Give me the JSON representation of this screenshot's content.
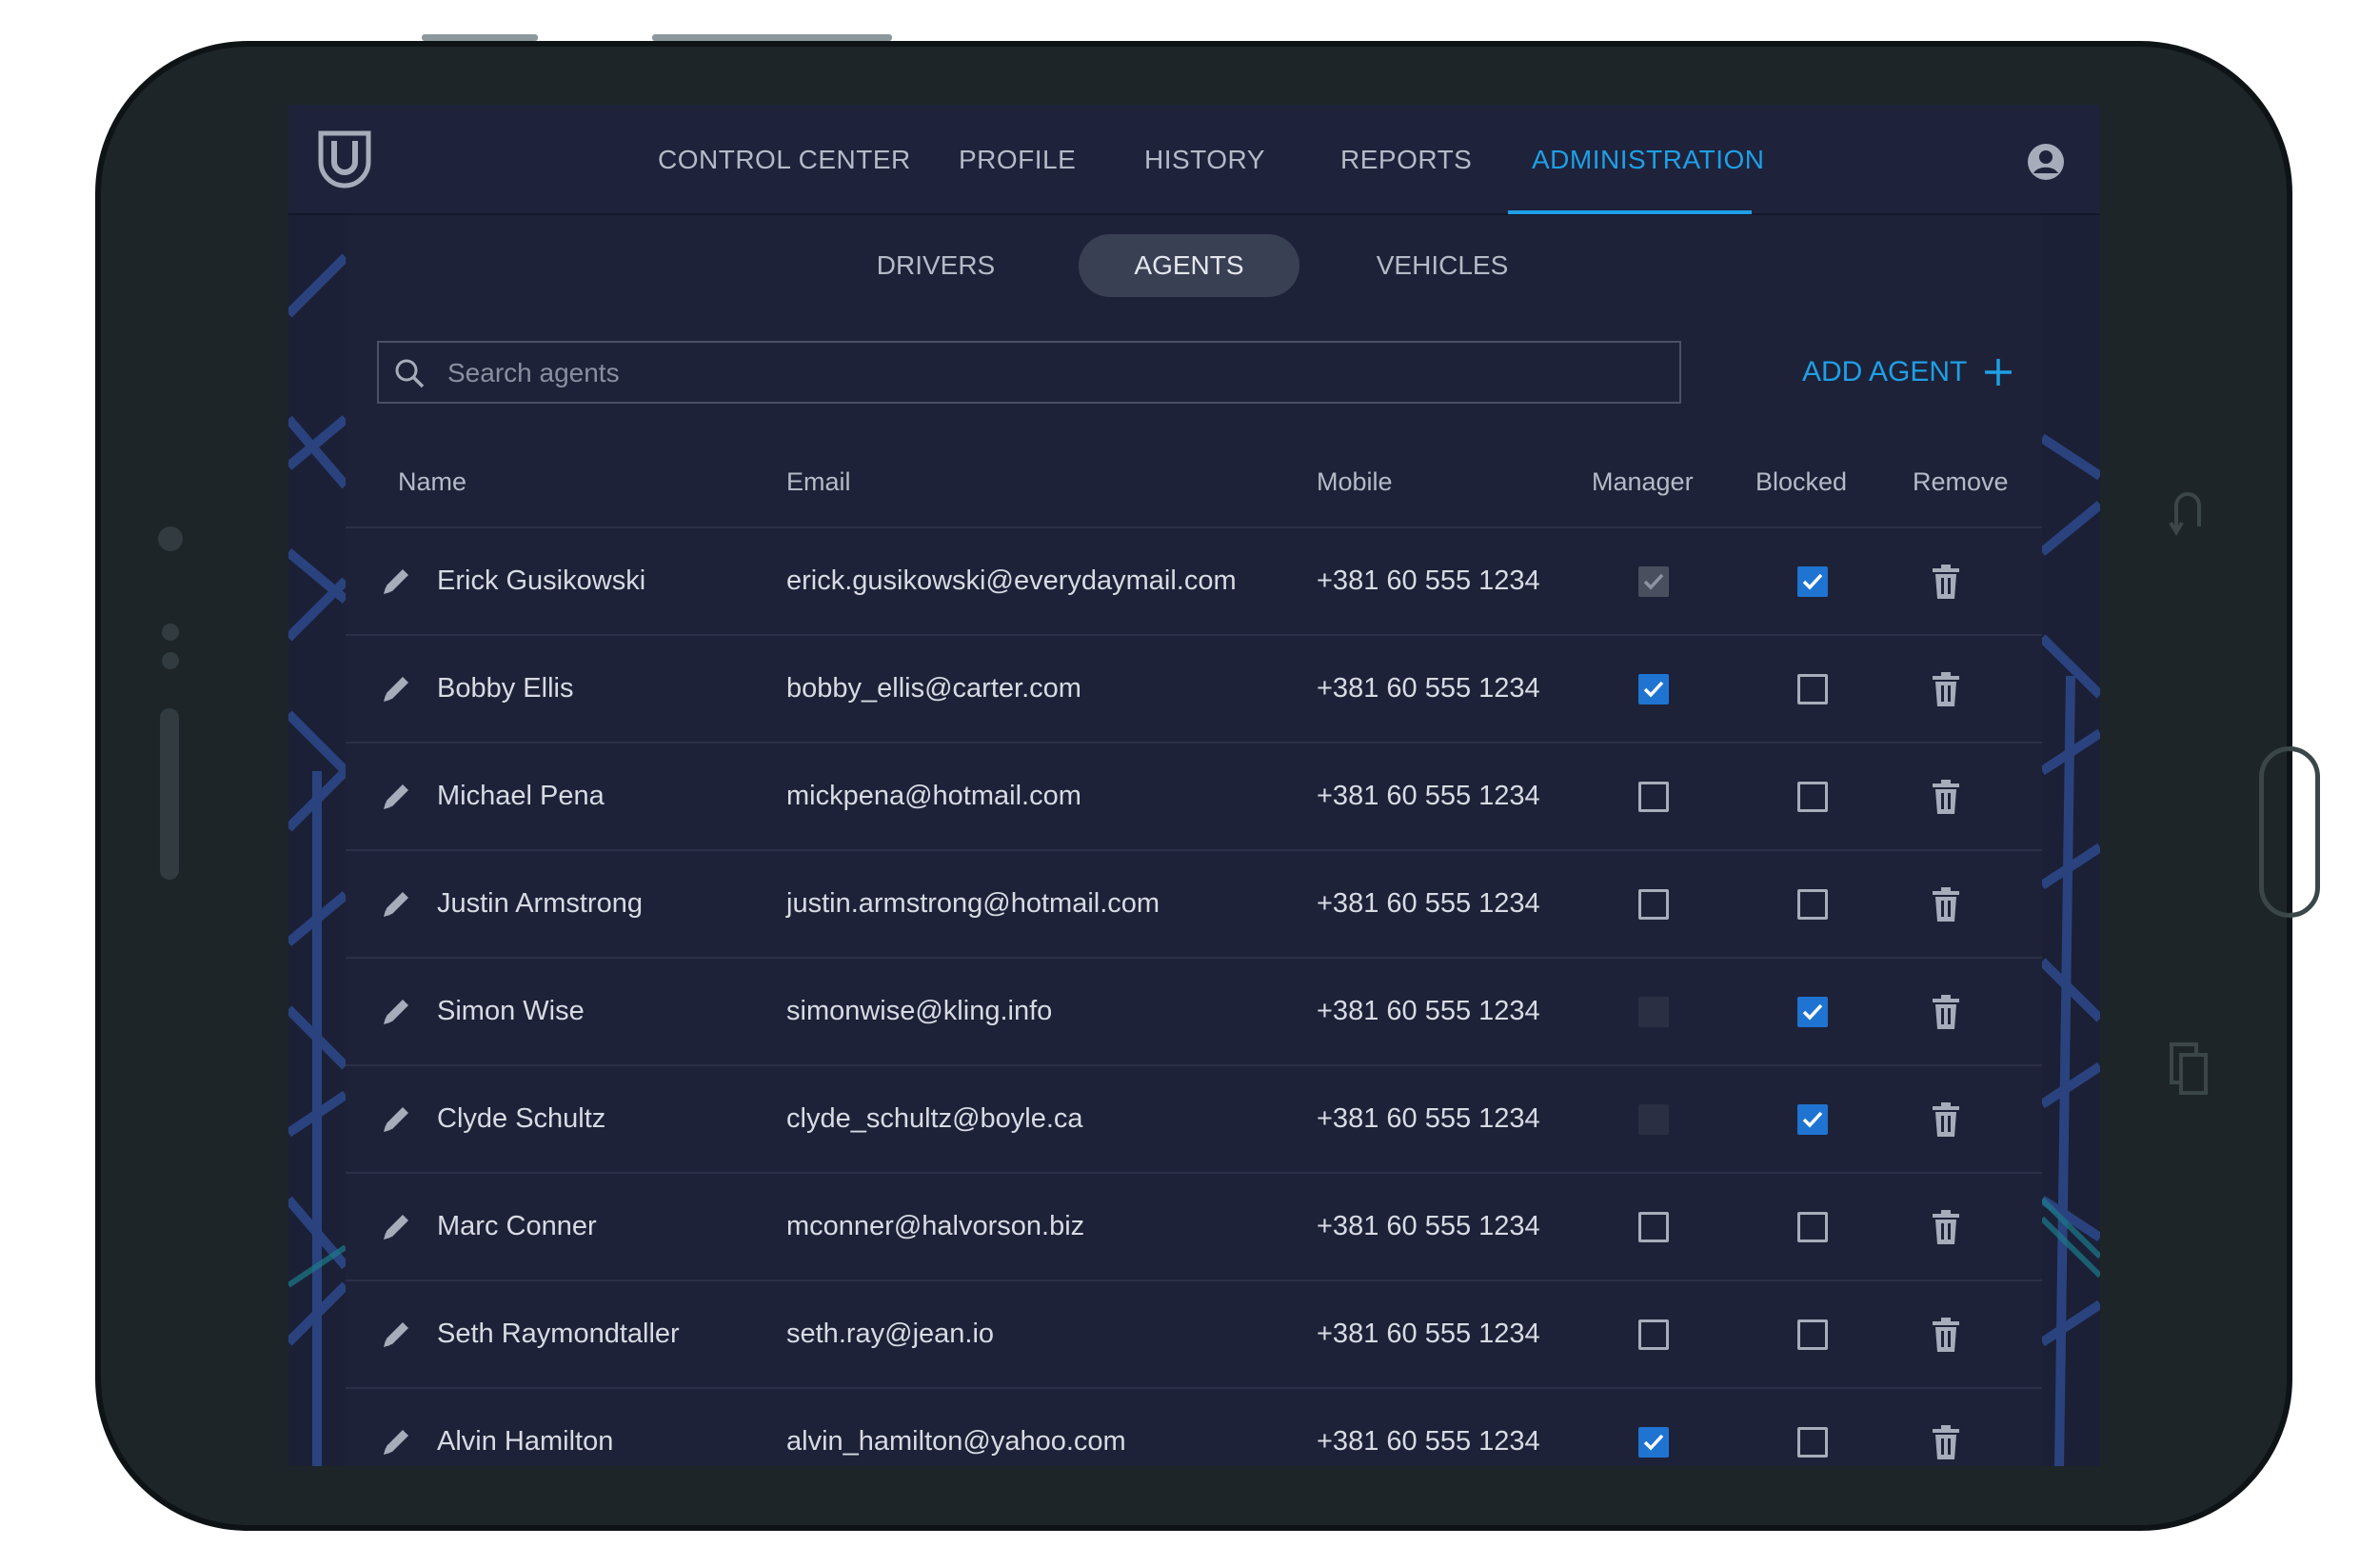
{
  "nav": {
    "tabs": [
      {
        "label": "CONTROL CENTER"
      },
      {
        "label": "PROFILE"
      },
      {
        "label": "HISTORY"
      },
      {
        "label": "REPORTS"
      },
      {
        "label": "ADMINISTRATION",
        "active": true
      }
    ]
  },
  "subtabs": [
    {
      "label": "DRIVERS"
    },
    {
      "label": "AGENTS",
      "active": true
    },
    {
      "label": "VEHICLES"
    }
  ],
  "search": {
    "placeholder": "Search agents",
    "value": ""
  },
  "add_button": {
    "label": "ADD AGENT"
  },
  "table": {
    "headers": {
      "name": "Name",
      "email": "Email",
      "mobile": "Mobile",
      "manager": "Manager",
      "blocked": "Blocked",
      "remove": "Remove"
    },
    "rows": [
      {
        "name": "Erick Gusikowski",
        "email": "erick.gusikowski@everydaymail.com",
        "mobile": "+381 60 555 1234",
        "manager": "disabled-checked",
        "blocked": "checked"
      },
      {
        "name": "Bobby Ellis",
        "email": "bobby_ellis@carter.com",
        "mobile": "+381 60 555 1234",
        "manager": "checked",
        "blocked": "unchecked"
      },
      {
        "name": "Michael Pena",
        "email": "mickpena@hotmail.com",
        "mobile": "+381 60 555 1234",
        "manager": "unchecked",
        "blocked": "unchecked"
      },
      {
        "name": "Justin Armstrong",
        "email": "justin.armstrong@hotmail.com",
        "mobile": "+381 60 555 1234",
        "manager": "unchecked",
        "blocked": "unchecked"
      },
      {
        "name": "Simon Wise",
        "email": "simonwise@kling.info",
        "mobile": "+381 60 555 1234",
        "manager": "disabled",
        "blocked": "checked"
      },
      {
        "name": "Clyde Schultz",
        "email": "clyde_schultz@boyle.ca",
        "mobile": "+381 60 555 1234",
        "manager": "disabled",
        "blocked": "checked"
      },
      {
        "name": "Marc Conner",
        "email": "mconner@halvorson.biz",
        "mobile": "+381 60 555 1234",
        "manager": "unchecked",
        "blocked": "unchecked"
      },
      {
        "name": "Seth Raymondtaller",
        "email": "seth.ray@jean.io",
        "mobile": "+381 60 555 1234",
        "manager": "unchecked",
        "blocked": "unchecked"
      },
      {
        "name": "Alvin Hamilton",
        "email": "alvin_hamilton@yahoo.com",
        "mobile": "+381 60 555 1234",
        "manager": "checked",
        "blocked": "unchecked"
      }
    ]
  },
  "colors": {
    "accent": "#1f9fe6",
    "checkbox_checked": "#1f74d1",
    "background": "#1d2238"
  },
  "icons": [
    "shield-logo-icon",
    "user-avatar-icon",
    "search-icon",
    "plus-icon",
    "pencil-icon",
    "trash-icon",
    "checkmark-icon",
    "back-icon",
    "recent-apps-icon"
  ]
}
